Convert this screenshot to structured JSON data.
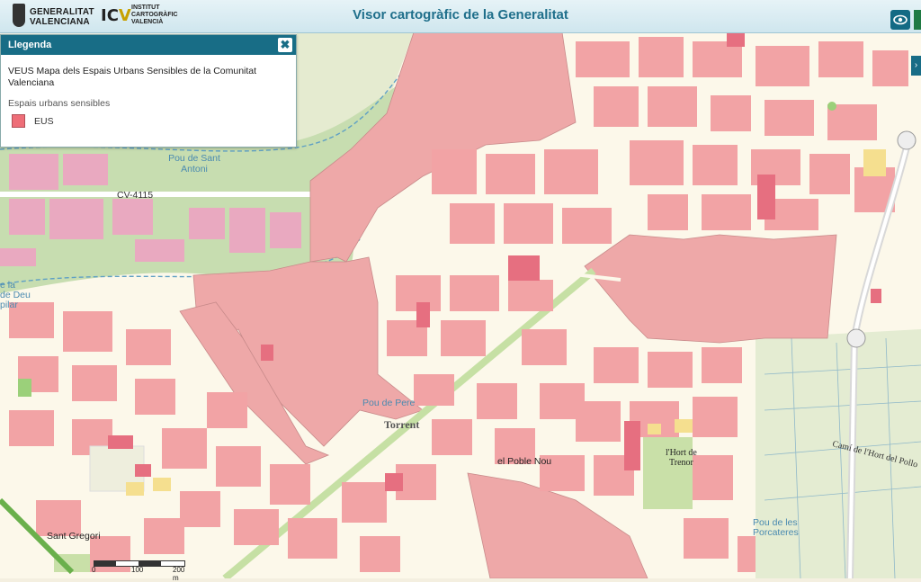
{
  "header": {
    "gva_line1": "GENERALITAT",
    "gva_line2": "VALENCIANA",
    "icv_line1": "INSTITUT",
    "icv_line2": "CARTOGRÀFIC",
    "icv_line3": "VALENCIÀ",
    "title": "Visor cartogràfic de la Generalitat",
    "eye_icon": "eye-icon"
  },
  "legend": {
    "header": "Llegenda",
    "close": "✖",
    "layer_title": "VEUS Mapa dels Espais Urbans Sensibles de la Comunitat Valenciana",
    "group": "Espais urbans sensibles",
    "item_label": "EUS",
    "item_color": "#ee6e78"
  },
  "map": {
    "labels": {
      "pou_sant_antoni_1": "Pou de Sant",
      "pou_sant_antoni_2": "Antoni",
      "road_cv4115": "CV-4115",
      "deu_1": "e la",
      "deu_2": "de Deu",
      "deu_3": "pilar",
      "pou_pere": "Pou de Pere",
      "torrent": "Torrent",
      "poble_nou": "el Poble Nou",
      "hort_1": "l'Hort de",
      "hort_2": "Trenor",
      "cami": "Camí de l'Hort del Pollo",
      "sant_gregori": "Sant Gregori",
      "porcateres_1": "Pou de les",
      "porcateres_2": "Porcateres"
    },
    "colors": {
      "eus_fill": "#eea8a8",
      "building": "#f2a3a5",
      "street": "#fcf8ea",
      "industrial": "#e8d6ee",
      "green": "#c9e0a8",
      "fields": "#e4ecd2",
      "river": "#b9d79e"
    }
  },
  "scale": {
    "t0": "0",
    "t1": "100",
    "t2": "200 m"
  }
}
